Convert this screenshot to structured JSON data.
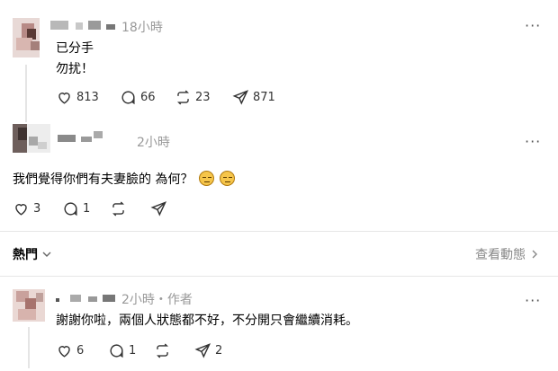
{
  "post": {
    "time": "18小時",
    "more_label": "···",
    "text_line1": "已分手",
    "text_line2": "勿扰！",
    "likes": "813",
    "comments": "66",
    "reposts": "23",
    "shares": "871"
  },
  "reply1": {
    "time": "2小時",
    "more_label": "···",
    "text": "我們覺得你們有夫妻臉的 為何？",
    "likes": "3",
    "comments": "1"
  },
  "sort_bar": {
    "label": "熱門",
    "view_activity": "查看動態"
  },
  "reply2": {
    "meta": "2小時・作者",
    "more_label": "···",
    "text": "謝謝你啦，兩個人狀態都不好，不分開只會繼續消耗。",
    "likes": "6",
    "comments": "1",
    "shares": "2"
  },
  "icons": [
    "heart-icon",
    "comment-icon",
    "repost-icon",
    "share-icon",
    "more-icon",
    "chevron-down-icon",
    "chevron-right-icon",
    "grimace-emoji"
  ]
}
